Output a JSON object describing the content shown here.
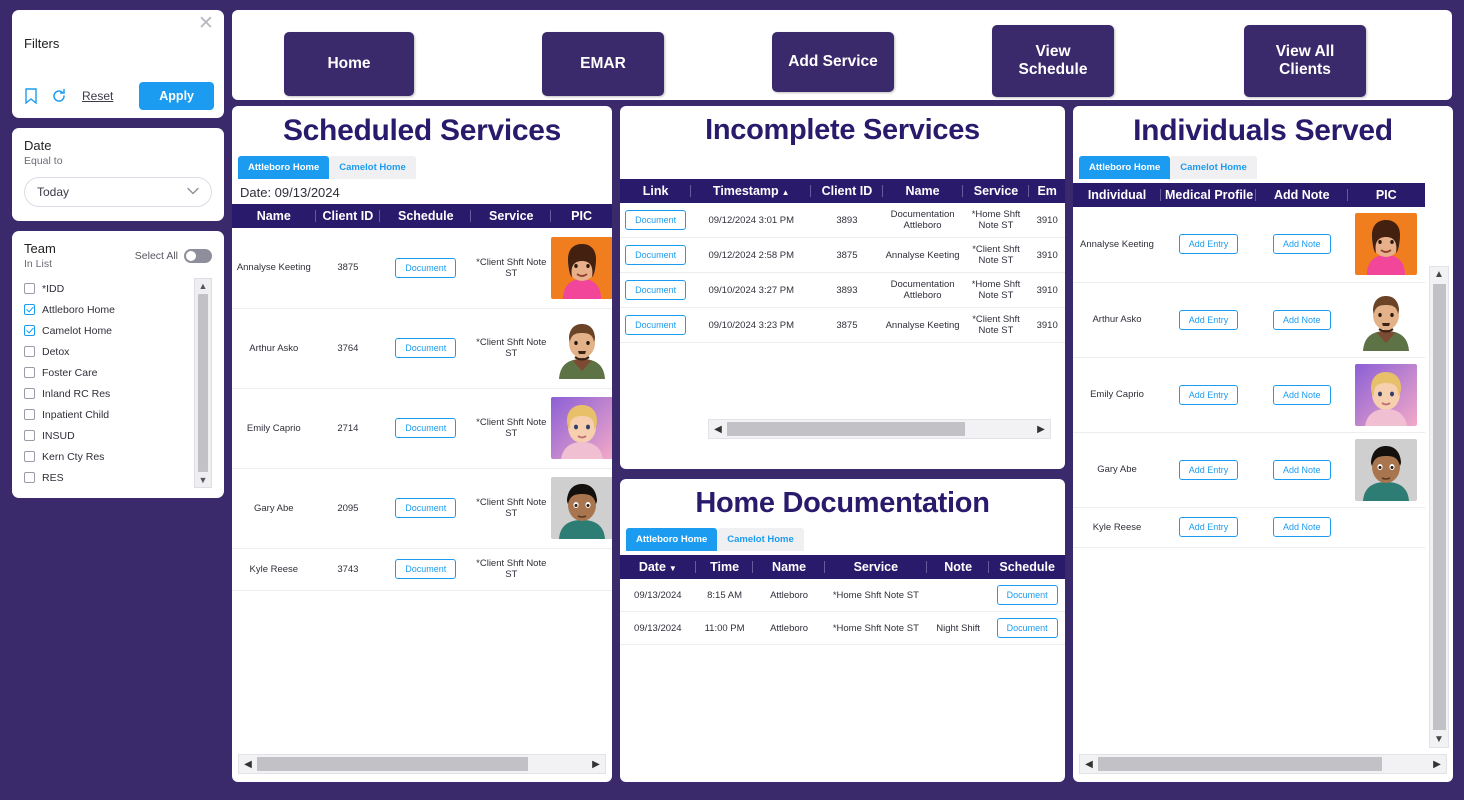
{
  "theme": {
    "purple": "#3a2a6b",
    "deep_purple": "#2a1a6b",
    "blue": "#1c9cf0"
  },
  "filters": {
    "title": "Filters",
    "close_label": "✕",
    "bookmark_icon": "bookmark-icon",
    "refresh_icon": "refresh-icon",
    "reset_label": "Reset",
    "apply_label": "Apply",
    "date": {
      "title": "Date",
      "subtitle": "Equal to",
      "value": "Today",
      "chevron": "⌄"
    },
    "team": {
      "title": "Team",
      "subtitle": "In List",
      "select_all_label": "Select All",
      "items": [
        {
          "label": "*IDD",
          "checked": false
        },
        {
          "label": "Attleboro Home",
          "checked": true
        },
        {
          "label": "Camelot Home",
          "checked": true
        },
        {
          "label": "Detox",
          "checked": false
        },
        {
          "label": "Foster Care",
          "checked": false
        },
        {
          "label": "Inland RC Res",
          "checked": false
        },
        {
          "label": "Inpatient Child",
          "checked": false
        },
        {
          "label": "INSUD",
          "checked": false
        },
        {
          "label": "Kern Cty Res",
          "checked": false
        },
        {
          "label": "RES",
          "checked": false
        }
      ]
    }
  },
  "topnav": {
    "home": "Home",
    "emar": "EMAR",
    "add_service": "Add Service",
    "view_schedule": "View\nSchedule",
    "view_all_clients": "View All\nClients"
  },
  "scheduled": {
    "title": "Scheduled Services",
    "tabs": [
      {
        "label": "Attleboro Home",
        "active": true
      },
      {
        "label": "Camelot Home",
        "active": false
      }
    ],
    "date_line": "Date: 09/13/2024",
    "columns": [
      "Name",
      "Client ID",
      "Schedule",
      "Service",
      "PIC"
    ],
    "rows": [
      {
        "name": "Annalyse Keeting",
        "client_id": "3875",
        "schedule": "Document",
        "service": "*Client Shft Note ST",
        "pic": "annalyse"
      },
      {
        "name": "Arthur Asko",
        "client_id": "3764",
        "schedule": "Document",
        "service": "*Client Shft Note ST",
        "pic": "arthur"
      },
      {
        "name": "Emily Caprio",
        "client_id": "2714",
        "schedule": "Document",
        "service": "*Client Shft Note ST",
        "pic": "emily"
      },
      {
        "name": "Gary Abe",
        "client_id": "2095",
        "schedule": "Document",
        "service": "*Client Shft Note ST",
        "pic": "gary"
      },
      {
        "name": "Kyle Reese",
        "client_id": "3743",
        "schedule": "Document",
        "service": "*Client Shft Note ST",
        "pic": ""
      }
    ]
  },
  "incomplete": {
    "title": "Incomplete Services",
    "columns": [
      "Link",
      "Timestamp",
      "Client ID",
      "Name",
      "Service",
      "Em"
    ],
    "sort_column": "Timestamp",
    "sort_caret": "▲",
    "rows": [
      {
        "link": "Document",
        "timestamp": "09/12/2024 3:01 PM",
        "client_id": "3893",
        "name": "Documentation Attleboro",
        "service": "*Home Shft Note ST",
        "em": "3910"
      },
      {
        "link": "Document",
        "timestamp": "09/12/2024 2:58 PM",
        "client_id": "3875",
        "name": "Annalyse Keeting",
        "service": "*Client Shft Note ST",
        "em": "3910"
      },
      {
        "link": "Document",
        "timestamp": "09/10/2024 3:27 PM",
        "client_id": "3893",
        "name": "Documentation Attleboro",
        "service": "*Home Shft Note ST",
        "em": "3910"
      },
      {
        "link": "Document",
        "timestamp": "09/10/2024 3:23 PM",
        "client_id": "3875",
        "name": "Annalyse Keeting",
        "service": "*Client Shft Note ST",
        "em": "3910"
      }
    ]
  },
  "homedoc": {
    "title": "Home Documentation",
    "tabs": [
      {
        "label": "Attleboro Home",
        "active": true
      },
      {
        "label": "Camelot Home",
        "active": false
      }
    ],
    "columns": [
      "Date",
      "Time",
      "Name",
      "Service",
      "Note",
      "Schedule"
    ],
    "sort_column": "Date",
    "sort_caret": "▼",
    "rows": [
      {
        "date": "09/13/2024",
        "time": "8:15 AM",
        "name": "Attleboro",
        "service": "*Home Shft Note ST",
        "note": "",
        "schedule": "Document"
      },
      {
        "date": "09/13/2024",
        "time": "11:00 PM",
        "name": "Attleboro",
        "service": "*Home Shft Note ST",
        "note": "Night Shift",
        "schedule": "Document"
      }
    ]
  },
  "individuals": {
    "title": "Individuals Served",
    "tabs": [
      {
        "label": "Attleboro Home",
        "active": true
      },
      {
        "label": "Camelot Home",
        "active": false
      }
    ],
    "columns": [
      "Individual",
      "Medical Profile",
      "Add Note",
      "PIC"
    ],
    "rows": [
      {
        "name": "Annalyse Keeting",
        "medical_profile": "Add Entry",
        "add_note": "Add Note",
        "pic": "annalyse"
      },
      {
        "name": "Arthur Asko",
        "medical_profile": "Add Entry",
        "add_note": "Add Note",
        "pic": "arthur"
      },
      {
        "name": "Emily Caprio",
        "medical_profile": "Add Entry",
        "add_note": "Add Note",
        "pic": "emily"
      },
      {
        "name": "Gary Abe",
        "medical_profile": "Add Entry",
        "add_note": "Add Note",
        "pic": "gary"
      },
      {
        "name": "Kyle Reese",
        "medical_profile": "Add Entry",
        "add_note": "Add Note",
        "pic": ""
      }
    ]
  },
  "scrollbars": {
    "left_arrow": "◀",
    "right_arrow": "▶",
    "up_arrow": "▲",
    "down_arrow": "▼"
  }
}
